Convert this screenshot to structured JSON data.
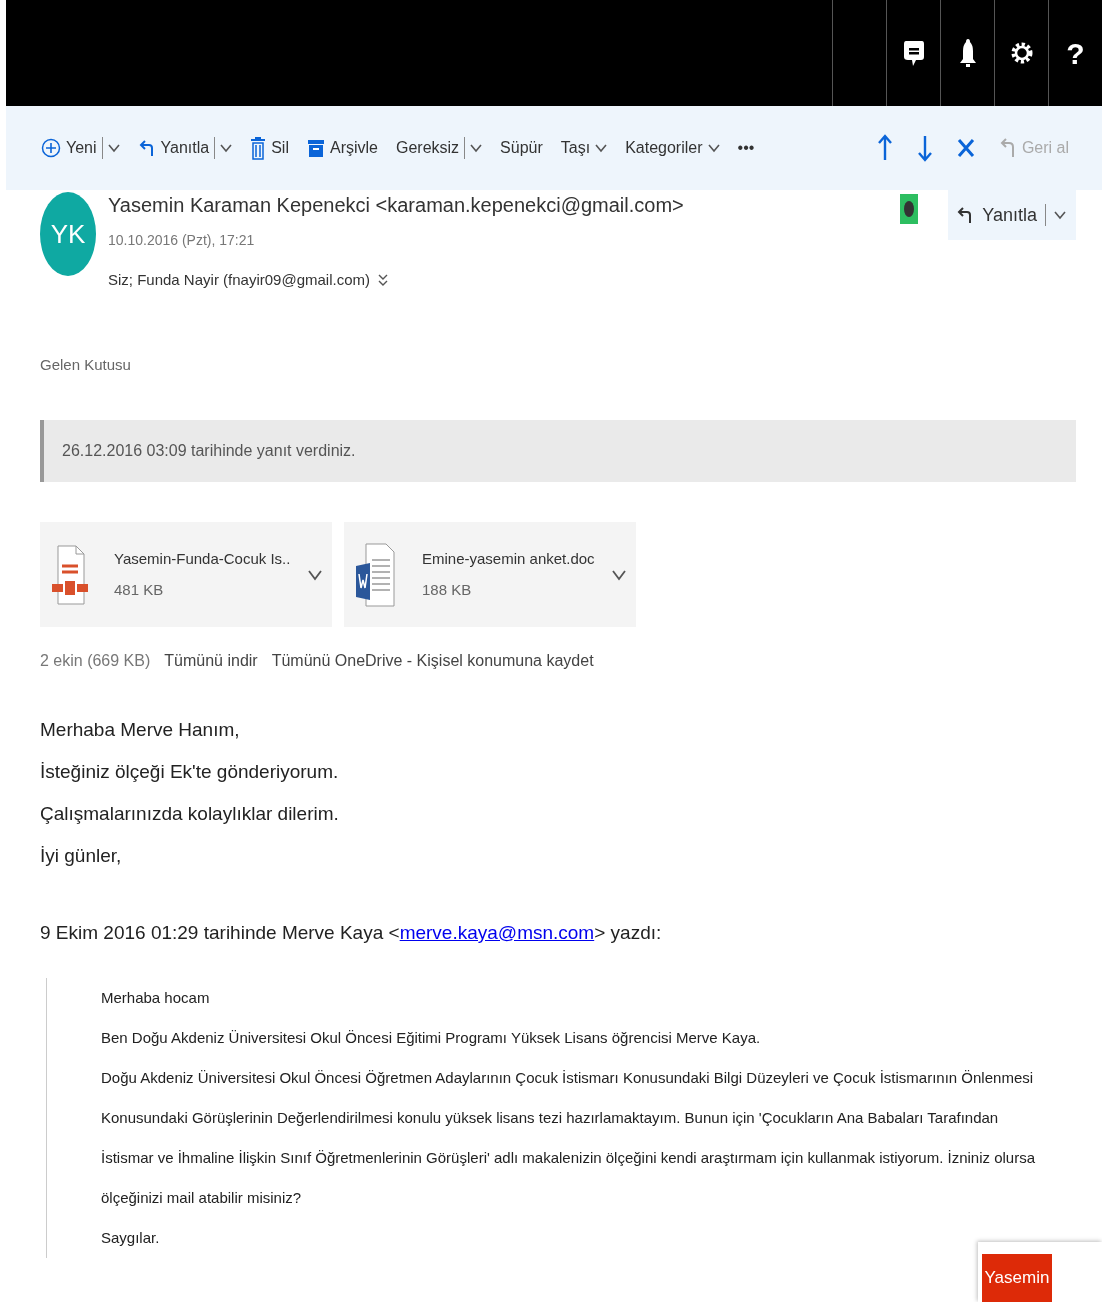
{
  "top_bar": {
    "help": "?"
  },
  "toolbar": {
    "items": [
      {
        "label": "Yeni",
        "kind": "split"
      },
      {
        "label": "Yanıtla",
        "kind": "split"
      },
      {
        "label": "Sil",
        "kind": "plain"
      },
      {
        "label": "Arşivle",
        "kind": "plain"
      },
      {
        "label": "Gereksiz",
        "kind": "split"
      },
      {
        "label": "Süpür",
        "kind": "plain"
      },
      {
        "label": "Taşı",
        "kind": "menu"
      },
      {
        "label": "Kategoriler",
        "kind": "menu"
      },
      {
        "label": "•••",
        "kind": "plain"
      }
    ],
    "right": [
      {
        "disabled": false
      },
      {
        "disabled": false
      },
      {
        "disabled": false
      },
      {
        "label": "Geri al",
        "disabled": true
      }
    ]
  },
  "message": {
    "initials": "YK",
    "sender": "Yasemin Karaman Kepenekci <karaman.kepenekci@gmail.com>",
    "date": "10.10.2016 (Pzt), 17:21",
    "recipients": "Siz; Funda Nayir (fnayir09@gmail.com)",
    "reply": "Yanıtla"
  },
  "folder": "Gelen Kutusu",
  "notice": "26.12.2016 03:09 tarihinde yanıt verdiniz.",
  "attachments": [
    {
      "kind": "pdf",
      "name": "Yasemin-Funda-Cocuk Is..",
      "size": "481 KB"
    },
    {
      "kind": "word",
      "name": "Emine-yasemin anket.doc",
      "size": "188 KB"
    }
  ],
  "attachment_summary": {
    "count": "2 ekin (669 KB)",
    "download_all": "Tümünü indir",
    "save_all": "Tümünü OneDrive - Kişisel konumuna kaydet"
  },
  "body": [
    "Merhaba Merve Hanım,",
    "İsteğiniz ölçeği Ek'te gönderiyorum.",
    "Çalışmalarınızda kolaylıklar dilerim.",
    "İyi günler,"
  ],
  "quote_header": {
    "before": "9 Ekim 2016 01:29 tarihinde Merve Kaya <",
    "link": "merve.kaya@msn.com",
    "after": "> yazdı:"
  },
  "quote": [
    "Merhaba hocam",
    "Ben Doğu Akdeniz Üniversitesi Okul Öncesi Eğitimi Programı Yüksek Lisans öğrencisi Merve Kaya.",
    "Doğu Akdeniz Üniversitesi  Okul Öncesi Öğretmen Adaylarının Çocuk İstismarı Konusundaki Bilgi Düzeyleri ve Çocuk İstismarının Önlenmesi Konusundaki Görüşlerinin Değerlendirilmesi konulu yüksek lisans tezi hazırlamaktayım. Bunun için  'Çocukların Ana Babaları Tarafından İstismar ve İhmaline İlişkin Sınıf Öğretmenlerinin Görüşleri' adlı makalenizin ölçeğini kendi araştırmam için kullanmak istiyorum. İzniniz olursa ölçeğinizi mail atabilir misiniz?",
    "Saygılar."
  ],
  "chat_tab": "Yasemin"
}
